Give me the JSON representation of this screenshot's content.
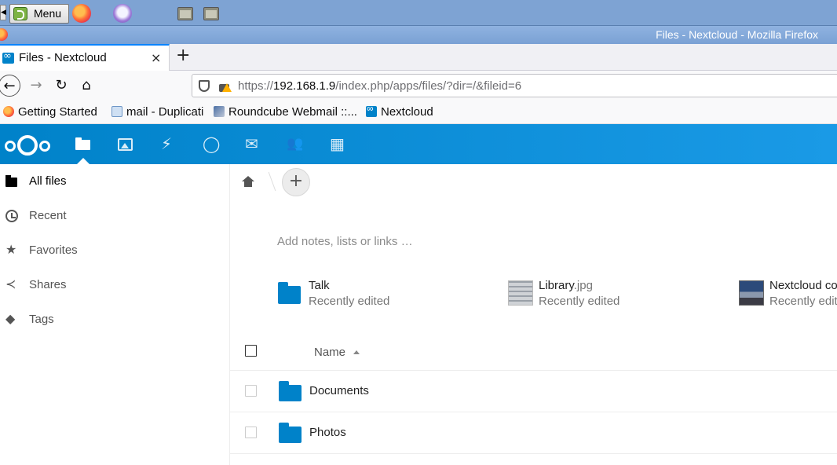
{
  "taskbar": {
    "menu_label": "Menu",
    "icons": [
      "mint-logo-icon",
      "firefox-icon",
      "bird-app-icon",
      "folder-icon",
      "folder-icon"
    ]
  },
  "window": {
    "title": "Files - Nextcloud - Mozilla Firefox"
  },
  "tab": {
    "label": "Files - Nextcloud",
    "close": "×",
    "new_tab": "+"
  },
  "nav": {
    "back": "←",
    "forward": "→",
    "reload": "↻",
    "home": "⌂"
  },
  "url": {
    "scheme": "https://",
    "host": "192.168.1.9",
    "path": "/index.php/apps/files/?dir=/&fileid=6"
  },
  "bookmarks": [
    {
      "label": "Getting Started",
      "icon": "firefox-icon"
    },
    {
      "label": "mail - Duplicati",
      "icon": "duplicati-icon"
    },
    {
      "label": "Roundcube Webmail ::...",
      "icon": "roundcube-icon"
    },
    {
      "label": "Nextcloud",
      "icon": "nextcloud-icon"
    }
  ],
  "apps": {
    "activity_glyph": "⚡",
    "talk_glyph": "◯",
    "mail_glyph": "✉",
    "contacts_glyph": "👥",
    "calendar_glyph": "▦"
  },
  "sidebar": {
    "items": [
      {
        "label": "All files",
        "icon": "folder-icon"
      },
      {
        "label": "Recent",
        "icon": "clock-icon",
        "glyph": ""
      },
      {
        "label": "Favorites",
        "icon": "star-icon",
        "glyph": "★"
      },
      {
        "label": "Shares",
        "icon": "share-icon",
        "glyph": "≺"
      },
      {
        "label": "Tags",
        "icon": "tag-icon",
        "glyph": "◆"
      }
    ]
  },
  "main": {
    "add_label": "+",
    "notes_placeholder": "Add notes, lists or links …",
    "recent": [
      {
        "name": "Talk",
        "ext": "",
        "sub": "Recently edited"
      },
      {
        "name": "Library",
        "ext": ".jpg",
        "sub": "Recently edited"
      },
      {
        "name": "Nextcloud co",
        "ext": "",
        "sub": "Recently edit"
      }
    ],
    "column_name": "Name",
    "files": [
      {
        "name": "Documents"
      },
      {
        "name": "Photos"
      }
    ]
  },
  "colors": {
    "nextcloud_blue": "#0082c9",
    "taskbar": "#7ea3d3",
    "firefox_accent": "#0a84ff"
  }
}
